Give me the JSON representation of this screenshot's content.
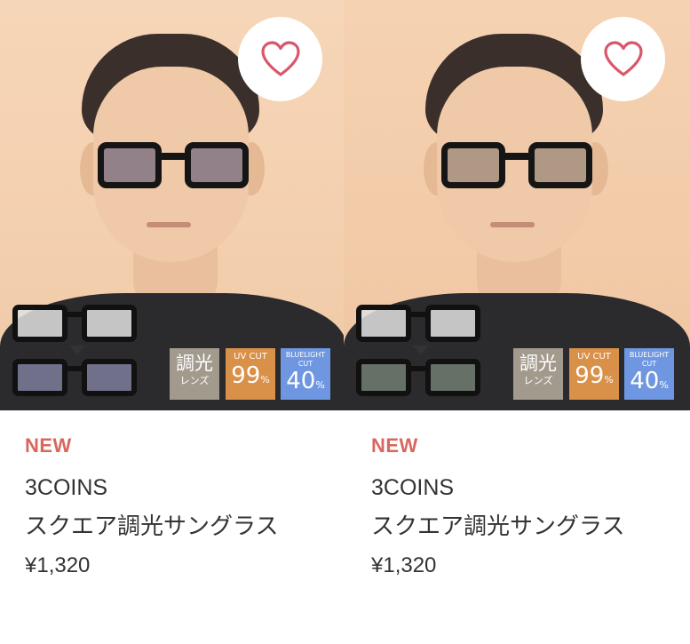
{
  "products": [
    {
      "tag": "NEW",
      "brand": "3COINS",
      "name": "スクエア調光サングラス",
      "price": "¥1,320",
      "badges": {
        "photochromic": {
          "top": "調光",
          "bottom": "レンズ"
        },
        "uv": {
          "label": "UV CUT",
          "value": "99",
          "unit": "%"
        },
        "bluelight": {
          "label1": "BLUELIGHT",
          "label2": "CUT",
          "value": "40",
          "unit": "%"
        }
      },
      "favorite_icon": "heart-outline-icon"
    },
    {
      "tag": "NEW",
      "brand": "3COINS",
      "name": "スクエア調光サングラス",
      "price": "¥1,320",
      "badges": {
        "photochromic": {
          "top": "調光",
          "bottom": "レンズ"
        },
        "uv": {
          "label": "UV CUT",
          "value": "99",
          "unit": "%"
        },
        "bluelight": {
          "label1": "BLUELIGHT",
          "label2": "CUT",
          "value": "40",
          "unit": "%"
        }
      },
      "favorite_icon": "heart-outline-icon"
    }
  ],
  "colors": {
    "tag": "#d9675e",
    "heart": "#d9576a",
    "text": "#333333",
    "badge_photochromic": "#a39a8e",
    "badge_uv": "#d99048",
    "badge_bluelight": "#6f97e1"
  }
}
